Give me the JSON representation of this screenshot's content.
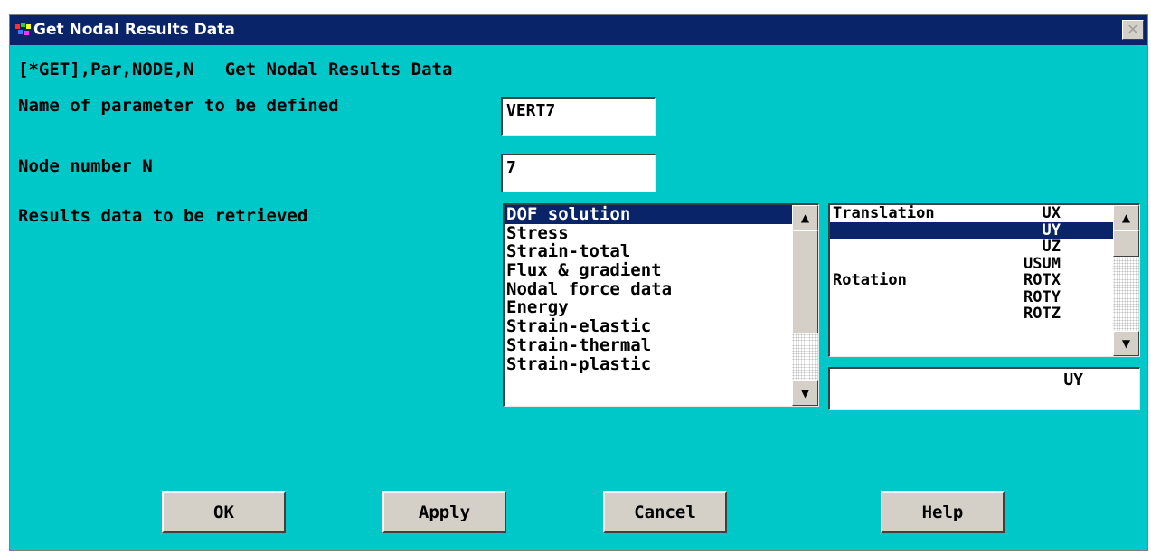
{
  "window": {
    "title": "Get Nodal Results Data",
    "close_glyph": "✕",
    "command_line": "[*GET],Par,NODE,N   Get Nodal Results Data"
  },
  "form": {
    "param_label": "Name of parameter to be defined",
    "param_value": "VERT7",
    "node_label": "Node number N",
    "node_value": "7",
    "results_label": "Results data to be retrieved"
  },
  "results_list": {
    "selected_index": 0,
    "items": [
      "DOF solution",
      "Stress",
      "Strain-total",
      "Flux & gradient",
      "Nodal force data",
      "Energy",
      "Strain-elastic",
      "Strain-thermal",
      "Strain-plastic"
    ]
  },
  "component_list": {
    "selected_index": 1,
    "items": [
      {
        "category": "Translation",
        "code": "UX"
      },
      {
        "category": "",
        "code": "UY"
      },
      {
        "category": "",
        "code": "UZ"
      },
      {
        "category": "",
        "code": "USUM"
      },
      {
        "category": "Rotation",
        "code": "ROTX"
      },
      {
        "category": "",
        "code": "ROTY"
      },
      {
        "category": "",
        "code": "ROTZ"
      }
    ],
    "selected_value": "UY"
  },
  "buttons": {
    "ok": "OK",
    "apply": "Apply",
    "cancel": "Cancel",
    "help": "Help"
  },
  "colors": {
    "dialog_bg": "#00c8c8",
    "titlebar": "#0a246a",
    "selection": "#0a246a"
  },
  "icons": {
    "scroll_up": "▲",
    "scroll_down": "▼"
  }
}
